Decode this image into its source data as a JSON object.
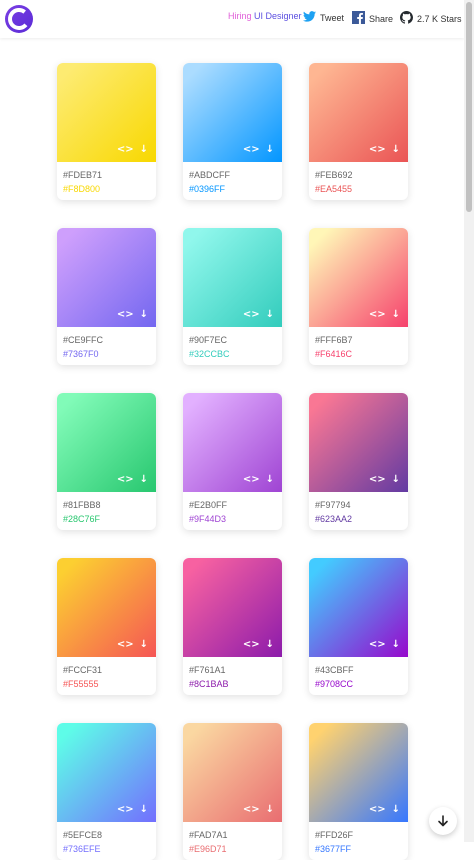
{
  "header": {
    "hiring_part1": "Hiring",
    "hiring_part2": "UI Designer",
    "tweet_label": "Tweet",
    "share_label": "Share",
    "stars_label": "2.7 K Stars"
  },
  "colors": {
    "brand": "#6a35e0",
    "tweet": "#1da1f2",
    "share": "#3b5998"
  },
  "icons": {
    "code": "code-icon",
    "download": "download-icon",
    "scroll": "arrow-down-icon"
  },
  "gradients": [
    {
      "c1": "#FDEB71",
      "c2": "#F8D800"
    },
    {
      "c1": "#ABDCFF",
      "c2": "#0396FF"
    },
    {
      "c1": "#FEB692",
      "c2": "#EA5455"
    },
    {
      "c1": "#CE9FFC",
      "c2": "#7367F0"
    },
    {
      "c1": "#90F7EC",
      "c2": "#32CCBC"
    },
    {
      "c1": "#FFF6B7",
      "c2": "#F6416C"
    },
    {
      "c1": "#81FBB8",
      "c2": "#28C76F"
    },
    {
      "c1": "#E2B0FF",
      "c2": "#9F44D3"
    },
    {
      "c1": "#F97794",
      "c2": "#623AA2"
    },
    {
      "c1": "#FCCF31",
      "c2": "#F55555"
    },
    {
      "c1": "#F761A1",
      "c2": "#8C1BAB"
    },
    {
      "c1": "#43CBFF",
      "c2": "#9708CC"
    },
    {
      "c1": "#5EFCE8",
      "c2": "#736EFE"
    },
    {
      "c1": "#FAD7A1",
      "c2": "#E96D71"
    },
    {
      "c1": "#FFD26F",
      "c2": "#3677FF"
    }
  ]
}
